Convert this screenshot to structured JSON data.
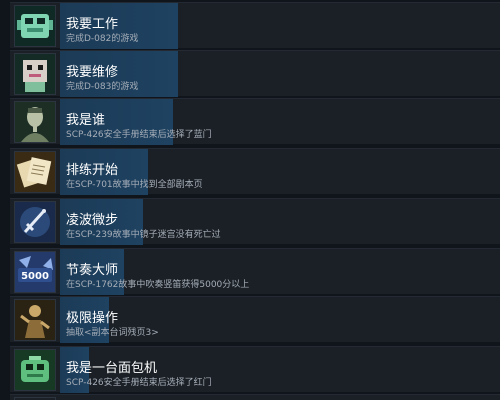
{
  "achievements": [
    {
      "title": "我要工作",
      "desc": "完成D-082的游戏",
      "progress": 0.24,
      "icon": "green-robot-icon"
    },
    {
      "title": "我要维修",
      "desc": "完成D-083的游戏",
      "progress": 0.24,
      "icon": "pink-robot-icon"
    },
    {
      "title": "我是谁",
      "desc": "SCP-426安全手册结束后选择了蓝门",
      "progress": 0.23,
      "icon": "man-portrait-icon"
    },
    {
      "title": "排练开始",
      "desc": "在SCP-701故事中找到全部剧本页",
      "progress": 0.18,
      "icon": "script-pages-icon"
    },
    {
      "title": "凌波微步",
      "desc": "在SCP-239故事中镜子迷宫没有死亡过",
      "progress": 0.17,
      "icon": "sword-icon"
    },
    {
      "title": "节奏大师",
      "desc": "在SCP-1762故事中吹奏竖笛获得5000分以上",
      "progress": 0.13,
      "icon": "score-5000-icon",
      "icon_text": "5000"
    },
    {
      "title": "极限操作",
      "desc": "抽取<副本台词残页3>",
      "progress": 0.1,
      "icon": "fighter-icon"
    },
    {
      "title": "我是一台面包机",
      "desc": "SCP-426安全手册结束后选择了红门",
      "progress": 0.06,
      "icon": "toaster-icon"
    }
  ],
  "colors": {
    "row_bg": "#1b2026",
    "progress_fill": "#1e4261",
    "title": "#ffffff",
    "description": "#a6aeb8"
  }
}
